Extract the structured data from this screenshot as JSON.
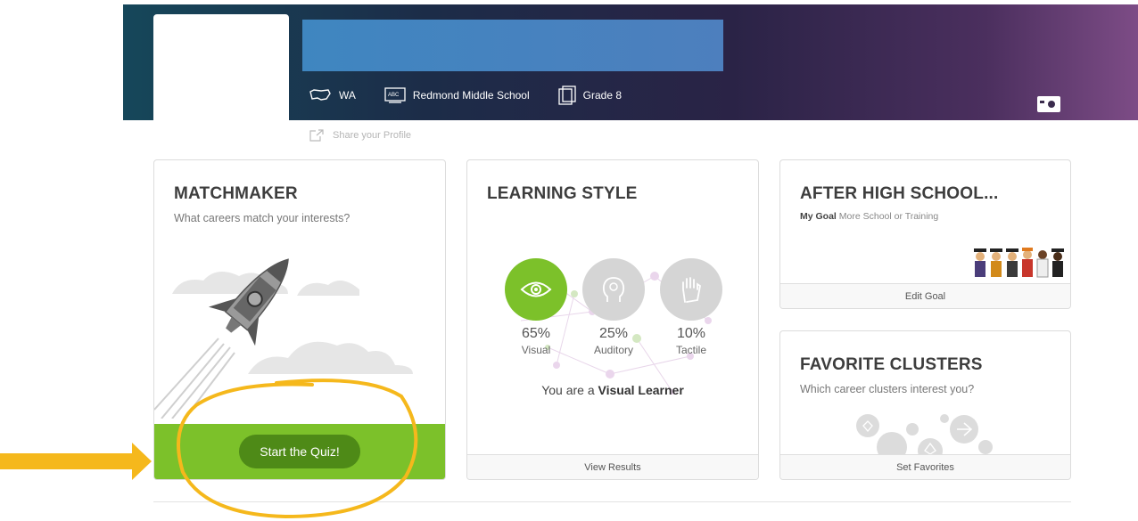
{
  "profile": {
    "location": "WA",
    "school": "Redmond Middle School",
    "grade": "Grade 8",
    "share_label": "Share your Profile"
  },
  "matchmaker": {
    "title": "MATCHMAKER",
    "subtitle": "What careers match your interests?",
    "button_label": "Start the Quiz!"
  },
  "learning_style": {
    "title": "LEARNING STYLE",
    "styles": [
      {
        "percent": "65%",
        "label": "Visual",
        "icon": "eye-icon",
        "color": "#7cc12a"
      },
      {
        "percent": "25%",
        "label": "Auditory",
        "icon": "head-icon",
        "color": "#d5d5d5"
      },
      {
        "percent": "10%",
        "label": "Tactile",
        "icon": "hand-icon",
        "color": "#d5d5d5"
      }
    ],
    "result_prefix": "You are a ",
    "result_style": "Visual Learner",
    "footer_label": "View Results"
  },
  "after_high_school": {
    "title": "AFTER HIGH SCHOOL...",
    "goal_label": "My Goal",
    "goal_value": "More School or Training",
    "footer_label": "Edit Goal"
  },
  "favorite_clusters": {
    "title": "FAVORITE CLUSTERS",
    "subtitle": "Which career clusters interest you?",
    "footer_label": "Set Favorites"
  },
  "colors": {
    "accent_green": "#7cc12a",
    "button_green": "#4e8a17",
    "annotation": "#f5b81c"
  }
}
